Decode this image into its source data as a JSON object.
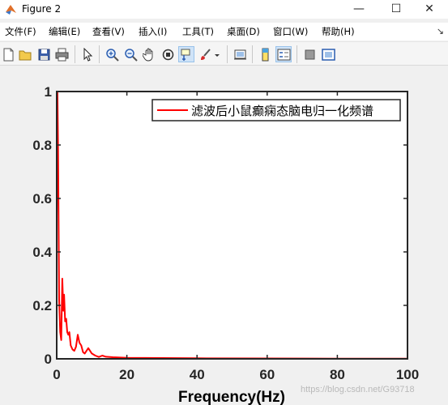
{
  "window": {
    "title": "Figure 2",
    "minimize_glyph": "—",
    "maximize_glyph": "☐",
    "close_glyph": "✕"
  },
  "menu": {
    "items": [
      {
        "label": "文件(F)"
      },
      {
        "label": "编辑(E)"
      },
      {
        "label": "查看(V)"
      },
      {
        "label": "插入(I)"
      },
      {
        "label": "工具(T)"
      },
      {
        "label": "桌面(D)"
      },
      {
        "label": "窗口(W)"
      },
      {
        "label": "帮助(H)"
      }
    ],
    "overflow_glyph": "↘"
  },
  "toolbar": {
    "buttons": [
      {
        "icon": "new-figure-icon"
      },
      {
        "icon": "open-file-icon"
      },
      {
        "icon": "save-icon"
      },
      {
        "icon": "print-icon"
      },
      {
        "icon": "edit-plot-arrow-icon"
      },
      {
        "icon": "zoom-in-icon"
      },
      {
        "icon": "zoom-out-icon"
      },
      {
        "icon": "pan-hand-icon"
      },
      {
        "icon": "rotate-3d-icon"
      },
      {
        "icon": "data-cursor-icon"
      },
      {
        "icon": "brush-icon"
      },
      {
        "icon": "link-plot-icon"
      },
      {
        "icon": "colorbar-icon"
      },
      {
        "icon": "legend-icon"
      },
      {
        "icon": "hide-plot-tools-icon"
      },
      {
        "icon": "show-plot-tools-icon"
      }
    ]
  },
  "watermark": "https://blog.csdn.net/G93718",
  "chart_data": {
    "type": "line",
    "xlabel": "Frequency(Hz)",
    "ylabel": "",
    "title": "",
    "xlim": [
      0,
      100
    ],
    "ylim": [
      0,
      1
    ],
    "xticks": [
      0,
      20,
      40,
      60,
      80,
      100
    ],
    "yticks": [
      0,
      0.2,
      0.4,
      0.6,
      0.8,
      1
    ],
    "xtick_labels": [
      "0",
      "20",
      "40",
      "60",
      "80",
      "100"
    ],
    "ytick_labels": [
      "0",
      "0.2",
      "0.4",
      "0.6",
      "0.8",
      "1"
    ],
    "grid": false,
    "legend_position": "top-right",
    "series": [
      {
        "name": "滤波后小鼠癫痫态脑电归一化频谱",
        "color": "#ff0000",
        "x": [
          0,
          0.2,
          0.4,
          0.7,
          1.0,
          1.3,
          1.6,
          1.9,
          2.1,
          2.4,
          2.7,
          3.0,
          3.3,
          3.6,
          4.0,
          4.5,
          5.0,
          5.5,
          6.0,
          6.5,
          7.0,
          7.5,
          8.0,
          8.5,
          9.0,
          10.0,
          11.0,
          12.0,
          13.0,
          14.0,
          16.0,
          20.0,
          30.0,
          40.0,
          60.0,
          80.0,
          100.0
        ],
        "y": [
          0.53,
          1.0,
          0.78,
          0.22,
          0.1,
          0.07,
          0.3,
          0.18,
          0.24,
          0.14,
          0.15,
          0.1,
          0.09,
          0.1,
          0.05,
          0.035,
          0.03,
          0.045,
          0.09,
          0.06,
          0.05,
          0.025,
          0.02,
          0.03,
          0.04,
          0.02,
          0.012,
          0.007,
          0.012,
          0.008,
          0.006,
          0.004,
          0.003,
          0.002,
          0.0015,
          0.001,
          0.001
        ]
      }
    ]
  }
}
